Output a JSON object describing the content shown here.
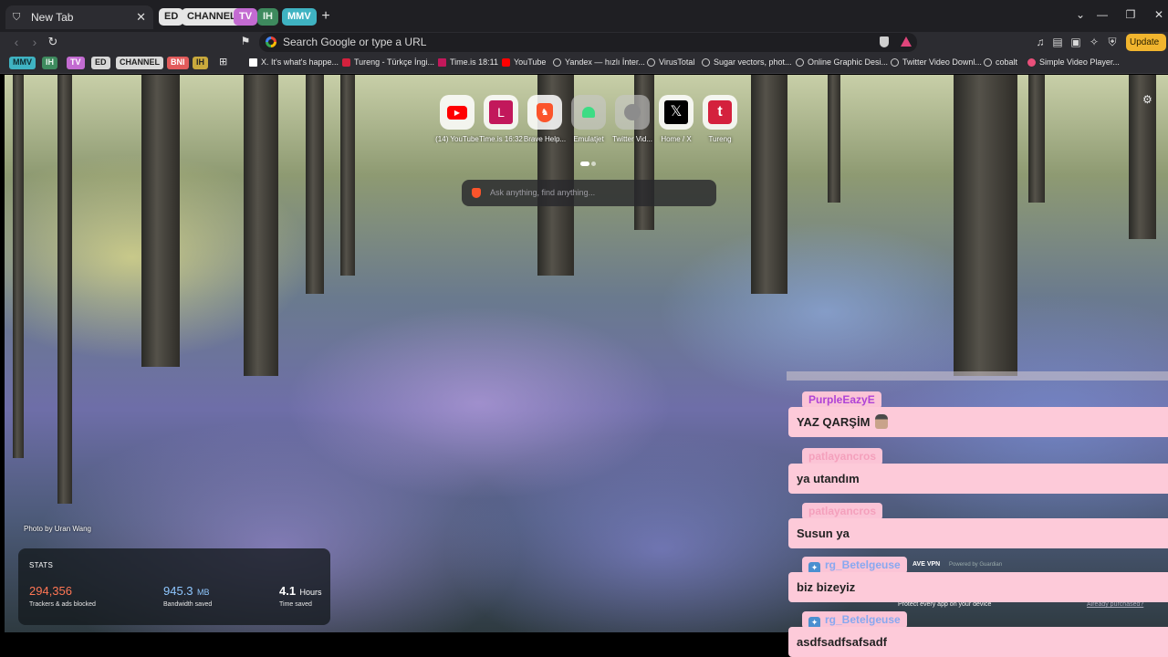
{
  "tabs": {
    "active_title": "New Tab",
    "groups": [
      {
        "label": "ED",
        "bg": "#e6e6e6",
        "fg": "#222"
      },
      {
        "label": "CHANNEL",
        "bg": "#e6e6e6",
        "fg": "#222"
      },
      {
        "label": "TV",
        "bg": "#c36bd1",
        "fg": "#fff"
      },
      {
        "label": "IH",
        "bg": "#3e8a5e",
        "fg": "#e8f5ec"
      },
      {
        "label": "MMV",
        "bg": "#3fb3c2",
        "fg": "#fff"
      }
    ]
  },
  "omnibox": {
    "placeholder": "Search Google or type a URL"
  },
  "toolbar": {
    "update_label": "Update"
  },
  "bookmarks": {
    "groups": [
      {
        "label": "MMV",
        "bg": "#3fb3c2",
        "fg": "#0d2a2f"
      },
      {
        "label": "IH",
        "bg": "#3e8a5e",
        "fg": "#e8f5ec"
      },
      {
        "label": "TV",
        "bg": "#c36bd1",
        "fg": "#fff"
      },
      {
        "label": "ED",
        "bg": "#d8d8d8",
        "fg": "#222"
      },
      {
        "label": "CHANNEL",
        "bg": "#d8d8d8",
        "fg": "#222"
      },
      {
        "label": "BNI",
        "bg": "#e25b5b",
        "fg": "#fff"
      },
      {
        "label": "IH",
        "bg": "#c9a93c",
        "fg": "#222"
      }
    ],
    "items": [
      {
        "label": "X. It's what's happe...",
        "icon": "x-icon"
      },
      {
        "label": "Tureng - Türkçe İngi...",
        "icon": "tureng-icon"
      },
      {
        "label": "Time.is 18:11",
        "icon": "time-icon"
      },
      {
        "label": "YouTube",
        "icon": "youtube-icon"
      },
      {
        "label": "Yandex — hızlı İnter...",
        "icon": "globe-icon"
      },
      {
        "label": "VirusTotal",
        "icon": "globe-icon"
      },
      {
        "label": "Sugar vectors, phot...",
        "icon": "globe-icon"
      },
      {
        "label": "Online Graphic Desi...",
        "icon": "globe-icon"
      },
      {
        "label": "Twitter Video Downl...",
        "icon": "globe-icon"
      },
      {
        "label": "cobalt",
        "icon": "globe-icon"
      },
      {
        "label": "Simple Video Player...",
        "icon": "player-icon"
      }
    ]
  },
  "top_sites": [
    {
      "label": "(14) YouTube",
      "icon": "youtube-icon"
    },
    {
      "label": "Time.is 16:32",
      "icon": "time-icon"
    },
    {
      "label": "Brave Help...",
      "icon": "brave-icon"
    },
    {
      "label": "Emulatjet",
      "icon": "android-icon"
    },
    {
      "label": "Twitter Vid...",
      "icon": "globe-icon"
    },
    {
      "label": "Home / X",
      "icon": "x-icon"
    },
    {
      "label": "Tureng",
      "icon": "tureng-icon"
    }
  ],
  "search": {
    "placeholder": "Ask anything, find anything..."
  },
  "photo_credit": "Photo by Uran Wang",
  "stats": {
    "heading": "STATS",
    "trackers": {
      "value": "294,356",
      "label": "Trackers & ads blocked",
      "color": "#ff7654"
    },
    "bandwidth": {
      "value": "945.3",
      "unit": "MB",
      "label": "Bandwidth saved",
      "color": "#8fc7ff"
    },
    "time": {
      "value": "4.1",
      "unit": "Hours",
      "label": "Time saved",
      "color": "#ffffff"
    }
  },
  "vpn": {
    "title": "AVE VPN",
    "powered": "Powered by Guardian",
    "tagline": "Protect every app on your device",
    "link": "Already purchased?"
  },
  "chat": [
    {
      "user": "PurpleEazyE",
      "color": "#b043d6",
      "badge": false,
      "message": "YAZ QARŞİM",
      "emote": true
    },
    {
      "user": "patlayancros",
      "color": "#f4a0bc",
      "badge": false,
      "message": "ya utandım",
      "emote": false
    },
    {
      "user": "patlayancros",
      "color": "#f4a0bc",
      "badge": false,
      "message": "Susun ya",
      "emote": false
    },
    {
      "user": "rg_Betelgeuse",
      "color": "#88a8f0",
      "badge": true,
      "message": "biz bizeyiz",
      "emote": false
    },
    {
      "user": "rg_Betelgeuse",
      "color": "#88a8f0",
      "badge": true,
      "message": "asdfsadfsafsadf",
      "emote": false
    }
  ]
}
